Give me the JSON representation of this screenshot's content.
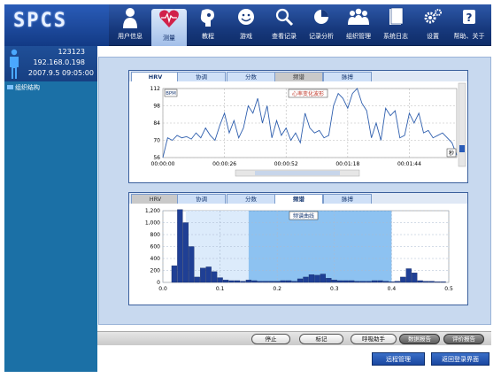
{
  "logo": "SPCS",
  "nav": [
    {
      "label": "用户信息",
      "icon": "user-icon"
    },
    {
      "label": "测量",
      "icon": "heart-icon"
    },
    {
      "label": "教程",
      "icon": "tutorial-icon"
    },
    {
      "label": "游戏",
      "icon": "smiley-icon"
    },
    {
      "label": "查看记录",
      "icon": "magnifier-icon"
    },
    {
      "label": "记录分析",
      "icon": "pie-chart-icon"
    },
    {
      "label": "组织管理",
      "icon": "group-icon"
    },
    {
      "label": "系统日志",
      "icon": "log-icon"
    },
    {
      "label": "设置",
      "icon": "gears-icon"
    },
    {
      "label": "帮助、关于",
      "icon": "help-icon"
    }
  ],
  "user": {
    "id": "123123",
    "ip": "192.168.0.198",
    "datetime": "2007.9.5   09:05:00"
  },
  "tree": {
    "label": "组织结构"
  },
  "top_panel": {
    "tabs": [
      "HRV",
      "协调",
      "分数",
      "频谱",
      "脉搏"
    ],
    "active_tab": 0,
    "y_unit": "BPM",
    "annotation": "心率变化波形",
    "x_unit": "秒"
  },
  "bottom_panel": {
    "tabs": [
      "HRV",
      "协调",
      "分数",
      "频谱",
      "脉搏"
    ],
    "active_tab": 3,
    "annotation": "频谱曲线"
  },
  "buttons": {
    "stop": "停止",
    "mark": "标记",
    "breath": "呼吸助手",
    "data_report": "数据报告",
    "eval_report": "评价报告",
    "remote": "远程管理",
    "back_login": "返回登录界面"
  },
  "chart_data": [
    {
      "type": "line",
      "x_ticks": [
        "00:00:00",
        "00:00:26",
        "00:00:52",
        "00:01:18",
        "00:01:44"
      ],
      "y_ticks": [
        56,
        70,
        84,
        98,
        112
      ],
      "ylim": [
        56,
        112
      ],
      "ylabel": "BPM",
      "xlabel": "秒",
      "grid": true,
      "x": [
        0,
        2,
        4,
        6,
        8,
        10,
        12,
        14,
        16,
        18,
        20,
        22,
        24,
        26,
        28,
        30,
        32,
        34,
        36,
        38,
        40,
        42,
        44,
        46,
        48,
        50,
        52,
        54,
        56,
        58,
        60,
        62,
        64,
        66,
        68,
        70,
        72,
        74,
        76,
        78,
        80,
        82,
        84,
        86,
        88,
        90,
        92,
        94,
        96,
        98,
        100,
        102,
        104,
        106,
        108,
        110,
        112,
        114,
        116,
        118,
        120,
        122,
        124
      ],
      "series": [
        {
          "values": [
            56,
            72,
            70,
            74,
            72,
            73,
            71,
            76,
            72,
            80,
            74,
            70,
            82,
            92,
            76,
            86,
            72,
            80,
            98,
            92,
            104,
            84,
            98,
            72,
            86,
            74,
            80,
            70,
            76,
            68,
            92,
            80,
            76,
            78,
            72,
            74,
            98,
            108,
            104,
            96,
            108,
            112,
            100,
            94,
            72,
            84,
            70,
            96,
            90,
            94,
            72,
            74,
            92,
            84,
            92,
            76,
            78,
            72,
            74,
            76,
            72,
            68,
            58
          ]
        }
      ]
    },
    {
      "type": "bar",
      "x": [
        0.02,
        0.03,
        0.04,
        0.05,
        0.06,
        0.07,
        0.08,
        0.09,
        0.1,
        0.11,
        0.12,
        0.13,
        0.14,
        0.15,
        0.16,
        0.17,
        0.18,
        0.19,
        0.2,
        0.21,
        0.22,
        0.23,
        0.24,
        0.25,
        0.26,
        0.27,
        0.28,
        0.29,
        0.3,
        0.31,
        0.32,
        0.33,
        0.34,
        0.35,
        0.36,
        0.37,
        0.38,
        0.39,
        0.4,
        0.41,
        0.42,
        0.43,
        0.44,
        0.45,
        0.46,
        0.47,
        0.48,
        0.49
      ],
      "values": [
        280,
        1220,
        1000,
        600,
        90,
        240,
        260,
        180,
        80,
        40,
        30,
        30,
        20,
        40,
        30,
        20,
        20,
        20,
        20,
        30,
        30,
        20,
        60,
        90,
        130,
        120,
        140,
        70,
        40,
        30,
        30,
        30,
        20,
        20,
        20,
        30,
        30,
        20,
        10,
        20,
        90,
        230,
        160,
        30,
        20,
        20,
        10,
        10
      ],
      "xlim": [
        0.0,
        0.5
      ],
      "ylim": [
        0,
        1200
      ],
      "x_ticks": [
        0.0,
        0.1,
        0.2,
        0.3,
        0.4,
        0.5
      ],
      "y_ticks": [
        0,
        200,
        400,
        600,
        800,
        1000,
        1200
      ],
      "grid": true
    }
  ],
  "colors": {
    "toolbar": "#17397d",
    "sidebar": "#1b70a6",
    "line": "#2f5fae",
    "bar": "#1f3f95",
    "band": "#2f8fe6"
  }
}
